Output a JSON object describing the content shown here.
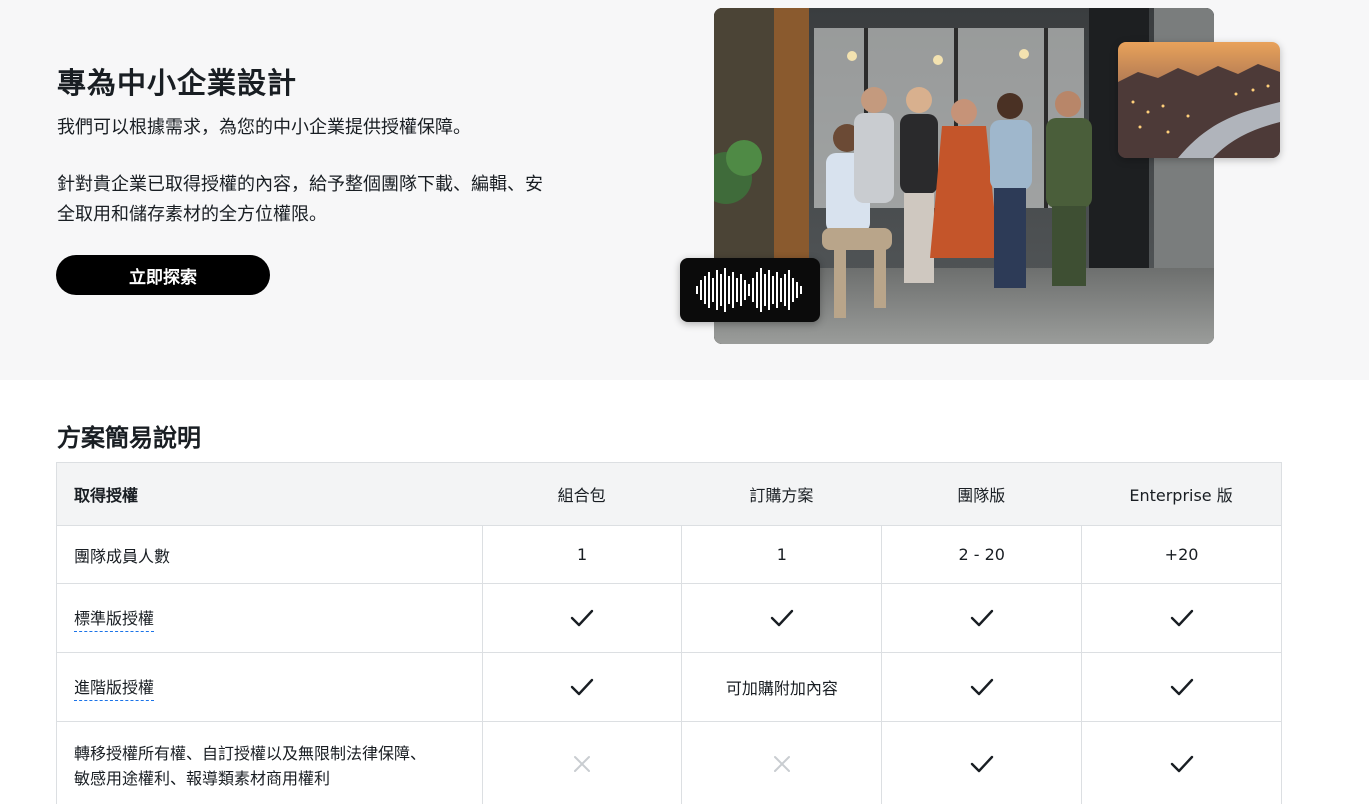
{
  "hero": {
    "title": "專為中小企業設計",
    "subtitle": "我們可以根據需求，為您的中小企業提供授權保障。",
    "body": "針對貴企業已取得授權的內容，給予整個團隊下載、編輯、安全取用和儲存素材的全方位權限。",
    "cta_label": "立即探索"
  },
  "plans": {
    "section_title": "方案簡易說明",
    "header": {
      "label": "取得授權",
      "columns": [
        "組合包",
        "訂購方案",
        "團隊版",
        "Enterprise 版"
      ]
    },
    "rows": [
      {
        "label": "團隊成員人數",
        "values": [
          "1",
          "1",
          "2 - 20",
          "+20"
        ]
      },
      {
        "label": "標準版授權",
        "values": [
          "check",
          "check",
          "check",
          "check"
        ]
      },
      {
        "label": "進階版授權",
        "values": [
          "check",
          "可加購附加內容",
          "check",
          "check"
        ]
      },
      {
        "label_line1": "轉移授權所有權、自訂授權以及無限制法律保障、",
        "label_line2": "敏感用途權利、報導類素材商用權利",
        "values": [
          "cross",
          "cross",
          "check",
          "check"
        ]
      }
    ]
  },
  "icons": {
    "check": "checkmark-icon",
    "cross": "x-mark-icon"
  },
  "colors": {
    "hero_bg": "#f7f7f8",
    "cta_bg": "#000000",
    "table_head_bg": "#f3f4f5",
    "dotted_link": "#1a73e8",
    "cross": "#c9cdd1"
  }
}
